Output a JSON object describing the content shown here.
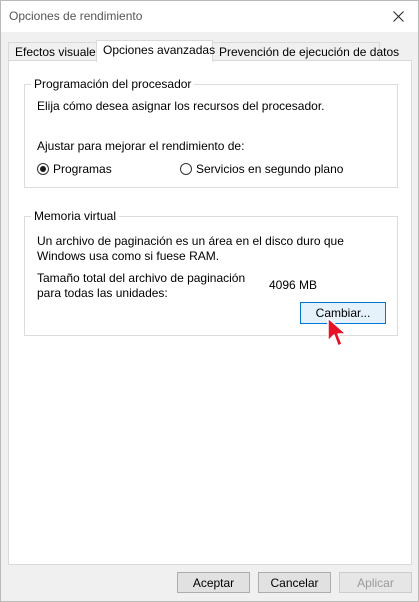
{
  "window": {
    "title": "Opciones de rendimiento"
  },
  "tabs": [
    {
      "label": "Efectos visuales"
    },
    {
      "label": "Opciones avanzadas"
    },
    {
      "label": "Prevención de ejecución de datos"
    }
  ],
  "processor_group": {
    "title": "Programación del procesador",
    "description": "Elija cómo desea asignar los recursos del procesador.",
    "adjust_label": "Ajustar para mejorar el rendimiento de:",
    "options": [
      {
        "label": "Programas",
        "selected": true
      },
      {
        "label": "Servicios en segundo plano",
        "selected": false
      }
    ]
  },
  "memory_group": {
    "title": "Memoria virtual",
    "description_line1": "Un archivo de paginación es un área en el disco duro que",
    "description_line2": "Windows usa como si fuese RAM.",
    "total_label_line1": "Tamaño total del archivo de paginación",
    "total_label_line2": "para todas las unidades:",
    "total_value": "4096 MB",
    "change_button": "Cambiar..."
  },
  "footer": {
    "accept": "Aceptar",
    "cancel": "Cancelar",
    "apply": "Aplicar"
  }
}
